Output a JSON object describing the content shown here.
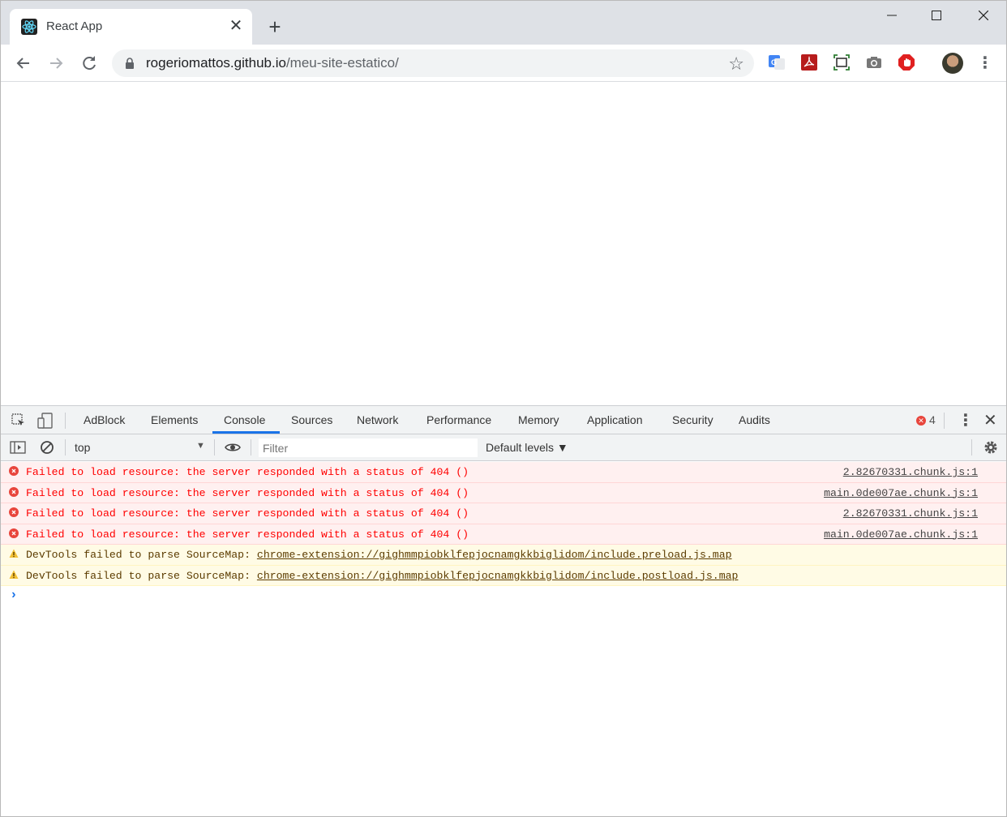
{
  "browser": {
    "tab": {
      "title": "React App",
      "close": "✕"
    },
    "new_tab": "+",
    "window_controls": {
      "minimize": "—",
      "maximize": "☐",
      "close": "✕"
    },
    "address": {
      "host": "rogeriomattos.github.io",
      "path": "/meu-site-estatico/"
    },
    "icons": [
      "back-icon",
      "forward-icon",
      "reload-icon",
      "lock-icon",
      "star-icon",
      "google-translate-icon",
      "pdf-icon",
      "screenshot-icon",
      "camera-icon",
      "adblock-icon",
      "profile-avatar",
      "menu-icon"
    ]
  },
  "devtools": {
    "tabs": [
      {
        "label": "AdBlock"
      },
      {
        "label": "Elements"
      },
      {
        "label": "Console",
        "active": true
      },
      {
        "label": "Sources"
      },
      {
        "label": "Network"
      },
      {
        "label": "Performance"
      },
      {
        "label": "Memory"
      },
      {
        "label": "Application"
      },
      {
        "label": "Security"
      },
      {
        "label": "Audits"
      }
    ],
    "error_count": "4",
    "console": {
      "context": "top",
      "filter_placeholder": "Filter",
      "levels": "Default levels ▼",
      "messages": [
        {
          "level": "error",
          "text": "Failed to load resource: the server responded with a status of 404 ()",
          "source": "2.82670331.chunk.js:1"
        },
        {
          "level": "error",
          "text": "Failed to load resource: the server responded with a status of 404 ()",
          "source": "main.0de007ae.chunk.js:1"
        },
        {
          "level": "error",
          "text": "Failed to load resource: the server responded with a status of 404 ()",
          "source": "2.82670331.chunk.js:1"
        },
        {
          "level": "error",
          "text": "Failed to load resource: the server responded with a status of 404 ()",
          "source": "main.0de007ae.chunk.js:1"
        },
        {
          "level": "warning",
          "text": "DevTools failed to parse SourceMap: ",
          "link": "chrome-extension://gighmmpiobklfepjocnamgkkbiglidom/include.preload.js.map"
        },
        {
          "level": "warning",
          "text": "DevTools failed to parse SourceMap: ",
          "link": "chrome-extension://gighmmpiobklfepjocnamgkkbiglidom/include.postload.js.map"
        }
      ],
      "prompt": "›"
    }
  },
  "colors": {
    "accent": "#1a73e8",
    "error": "#ff0000",
    "error_bg": "#fff0f0",
    "warning_bg": "#fffbe5"
  }
}
